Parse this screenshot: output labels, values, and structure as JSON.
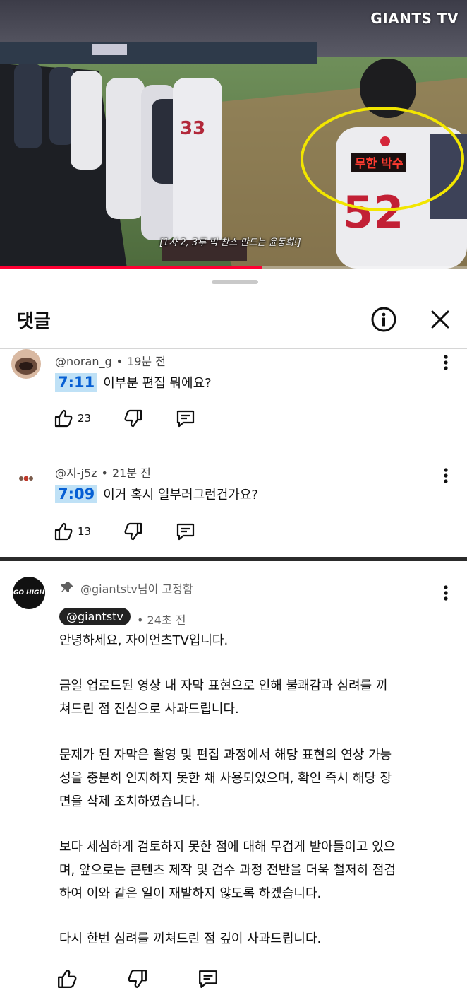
{
  "video": {
    "brand": "GIANTS TV",
    "subtitle": "[1사 2, 3루 빅 찬스 만드는 윤동희!]",
    "jersey_label": "무한 박수",
    "progress_fraction": 0.56,
    "colors": {
      "label_text": "#ff3b30",
      "circle": "#f2e600",
      "progress": "#ff0033"
    }
  },
  "sheet": {
    "title": "댓글",
    "info_icon": "info-icon",
    "close_icon": "close-icon",
    "comments": [
      {
        "author": "@noran_g",
        "time": "19분 전",
        "timestamp": "7:11",
        "text": "이부분 편집 뭐에요?",
        "likes": "23"
      },
      {
        "author": "@지-j5z",
        "time": "21분 전",
        "timestamp": "7:09",
        "text": "이거 혹시 일부러그런건가요?",
        "likes": "13"
      }
    ]
  },
  "pinned": {
    "pin_text": "@giantstv님이 고정함",
    "avatar_text": "GO HIGH",
    "author": "@giantstv",
    "time": "24초 전",
    "paragraphs": [
      [
        "안녕하세요, 자이언츠TV입니다."
      ],
      [
        "금일 업로드된 영상 내 자막 표현으로 인해 불쾌감과 심려를 끼",
        "쳐드린 점 진심으로 사과드립니다."
      ],
      [
        "문제가 된 자막은 촬영 및 편집 과정에서 해당 표현의 연상 가능",
        "성을 충분히 인지하지 못한 채 사용되었으며, 확인 즉시 해당 장",
        "면을 삭제 조치하였습니다."
      ],
      [
        "보다 세심하게 검토하지 못한 점에 대해 무겁게 받아들이고 있으",
        "며, 앞으로는 콘텐츠 제작 및 검수 과정 전반을 더욱 철저히 점검",
        "하여 이와 같은 일이 재발하지 않도록 하겠습니다."
      ],
      [
        "다시 한번 심려를 끼쳐드린 점 깊이 사과드립니다."
      ]
    ]
  }
}
